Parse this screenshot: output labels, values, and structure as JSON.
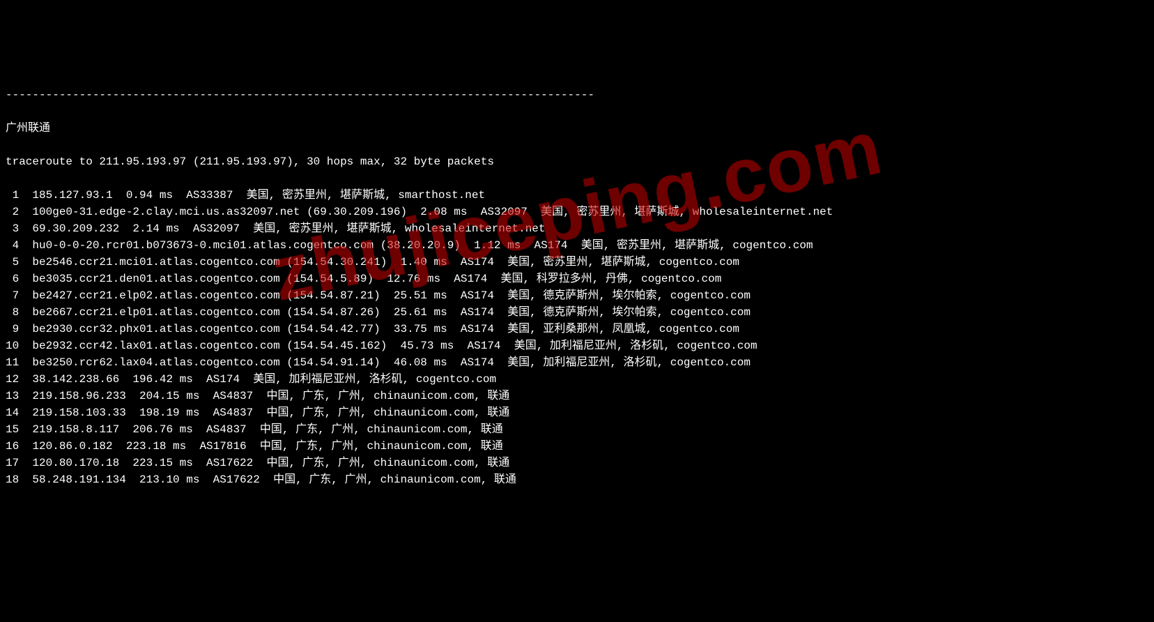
{
  "divider": "----------------------------------------------------------------------------------------",
  "title": "广州联通",
  "trace_header": "traceroute to 211.95.193.97 (211.95.193.97), 30 hops max, 32 byte packets",
  "hops": [
    {
      "n": " 1",
      "text": "185.127.93.1  0.94 ms  AS33387  美国, 密苏里州, 堪萨斯城, smarthost.net"
    },
    {
      "n": " 2",
      "text": "100ge0-31.edge-2.clay.mci.us.as32097.net (69.30.209.196)  2.08 ms  AS32097  美国, 密苏里州, 堪萨斯城, wholesaleinternet.net"
    },
    {
      "n": " 3",
      "text": "69.30.209.232  2.14 ms  AS32097  美国, 密苏里州, 堪萨斯城, wholesaleinternet.net"
    },
    {
      "n": " 4",
      "text": "hu0-0-0-20.rcr01.b073673-0.mci01.atlas.cogentco.com (38.20.20.9)  1.12 ms  AS174  美国, 密苏里州, 堪萨斯城, cogentco.com"
    },
    {
      "n": " 5",
      "text": "be2546.ccr21.mci01.atlas.cogentco.com (154.54.30.241)  1.40 ms  AS174  美国, 密苏里州, 堪萨斯城, cogentco.com"
    },
    {
      "n": " 6",
      "text": "be3035.ccr21.den01.atlas.cogentco.com (154.54.5.89)  12.76 ms  AS174  美国, 科罗拉多州, 丹佛, cogentco.com"
    },
    {
      "n": " 7",
      "text": "be2427.ccr21.elp02.atlas.cogentco.com (154.54.87.21)  25.51 ms  AS174  美国, 德克萨斯州, 埃尔帕索, cogentco.com"
    },
    {
      "n": " 8",
      "text": "be2667.ccr21.elp01.atlas.cogentco.com (154.54.87.26)  25.61 ms  AS174  美国, 德克萨斯州, 埃尔帕索, cogentco.com"
    },
    {
      "n": " 9",
      "text": "be2930.ccr32.phx01.atlas.cogentco.com (154.54.42.77)  33.75 ms  AS174  美国, 亚利桑那州, 凤凰城, cogentco.com"
    },
    {
      "n": "10",
      "text": "be2932.ccr42.lax01.atlas.cogentco.com (154.54.45.162)  45.73 ms  AS174  美国, 加利福尼亚州, 洛杉矶, cogentco.com"
    },
    {
      "n": "11",
      "text": "be3250.rcr62.lax04.atlas.cogentco.com (154.54.91.14)  46.08 ms  AS174  美国, 加利福尼亚州, 洛杉矶, cogentco.com"
    },
    {
      "n": "12",
      "text": "38.142.238.66  196.42 ms  AS174  美国, 加利福尼亚州, 洛杉矶, cogentco.com"
    },
    {
      "n": "13",
      "text": "219.158.96.233  204.15 ms  AS4837  中国, 广东, 广州, chinaunicom.com, 联通"
    },
    {
      "n": "14",
      "text": "219.158.103.33  198.19 ms  AS4837  中国, 广东, 广州, chinaunicom.com, 联通"
    },
    {
      "n": "15",
      "text": "219.158.8.117  206.76 ms  AS4837  中国, 广东, 广州, chinaunicom.com, 联通"
    },
    {
      "n": "16",
      "text": "120.86.0.182  223.18 ms  AS17816  中国, 广东, 广州, chinaunicom.com, 联通"
    },
    {
      "n": "17",
      "text": "120.80.170.18  223.15 ms  AS17622  中国, 广东, 广州, chinaunicom.com, 联通"
    },
    {
      "n": "18",
      "text": "58.248.191.134  213.10 ms  AS17622  中国, 广东, 广州, chinaunicom.com, 联通"
    }
  ],
  "watermark": "zhujiceping.com"
}
